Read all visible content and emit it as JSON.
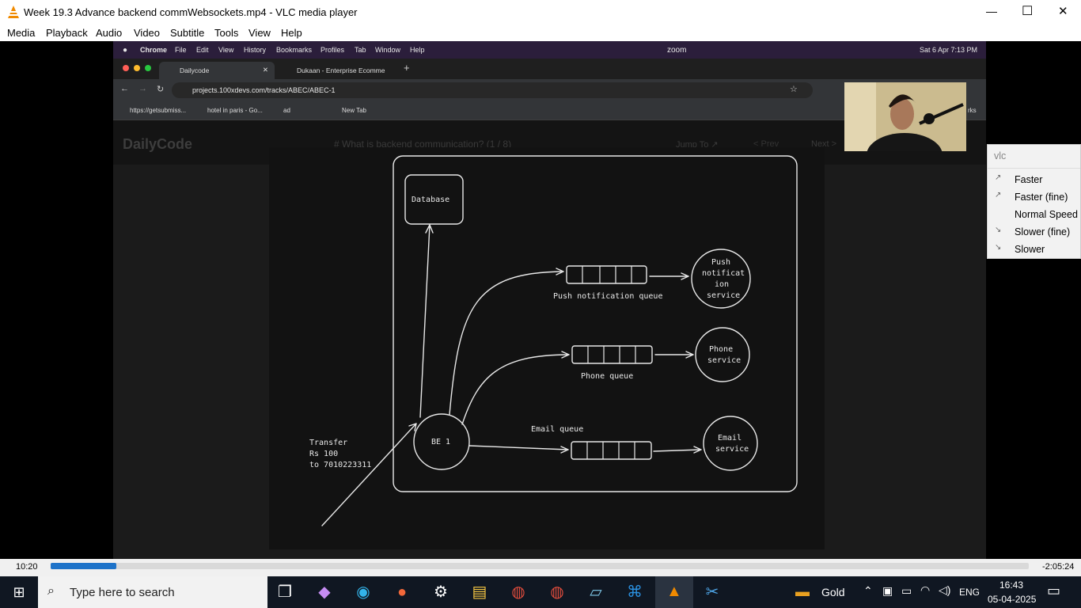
{
  "window": {
    "title": "Week 19.3  Advance backend commWebsockets.mp4 - VLC media player",
    "controls": [
      "—",
      "☐",
      "✕"
    ]
  },
  "menu": [
    "Media",
    "Playback",
    "Audio",
    "Video",
    "Subtitle",
    "Tools",
    "View",
    "Help"
  ],
  "mac": {
    "app": "Chrome",
    "menus": [
      "File",
      "Edit",
      "View",
      "History",
      "Bookmarks",
      "Profiles",
      "Tab",
      "Window",
      "Help"
    ],
    "zoom": "zoom",
    "datetime": "Sat 6 Apr  7:13 PM"
  },
  "tabs": [
    {
      "label": "Dailycode"
    },
    {
      "label": "Dukaan - Enterprise Ecomme"
    }
  ],
  "url": "projects.100xdevs.com/tracks/ABEC/ABEC-1",
  "bookmarks": [
    "https://getsubmiss...",
    "hotel in paris - Go...",
    "ad",
    "",
    "",
    "New Tab"
  ],
  "bookmarks_tail": "rks",
  "site": {
    "logo": "DailyCode",
    "heading": "# What is backend communication? (1 / 8)",
    "jump": "Jump To ↗",
    "prev": "< Prev",
    "next": "Next >"
  },
  "diagram": {
    "database": "Database",
    "be": "BE 1",
    "push_queue": "Push notification queue",
    "phone_queue": "Phone queue",
    "email_queue": "Email queue",
    "push_service": [
      "Push",
      "notificat",
      "ion",
      "service"
    ],
    "phone_service": [
      "Phone",
      "service"
    ],
    "email_service": [
      "Email",
      "service"
    ],
    "transfer": [
      "Transfer",
      "Rs 100",
      "to 7010223311"
    ]
  },
  "speed_menu": {
    "search": "vlc",
    "items": [
      "Faster",
      "Faster (fine)",
      "Normal Speed",
      "Slower (fine)",
      "Slower"
    ]
  },
  "controls": {
    "elapsed": "10:20",
    "remaining": "-2:05:24",
    "progress": 0.067
  },
  "taskbar": {
    "search_placeholder": "Type here to search",
    "gold": "Gold",
    "lang": "ENG",
    "time": "16:43",
    "date": "05-04-2025"
  },
  "colors": {
    "vlc_orange": "#f08a00",
    "progress": "#1e73c9",
    "taskbar": "#101722"
  }
}
